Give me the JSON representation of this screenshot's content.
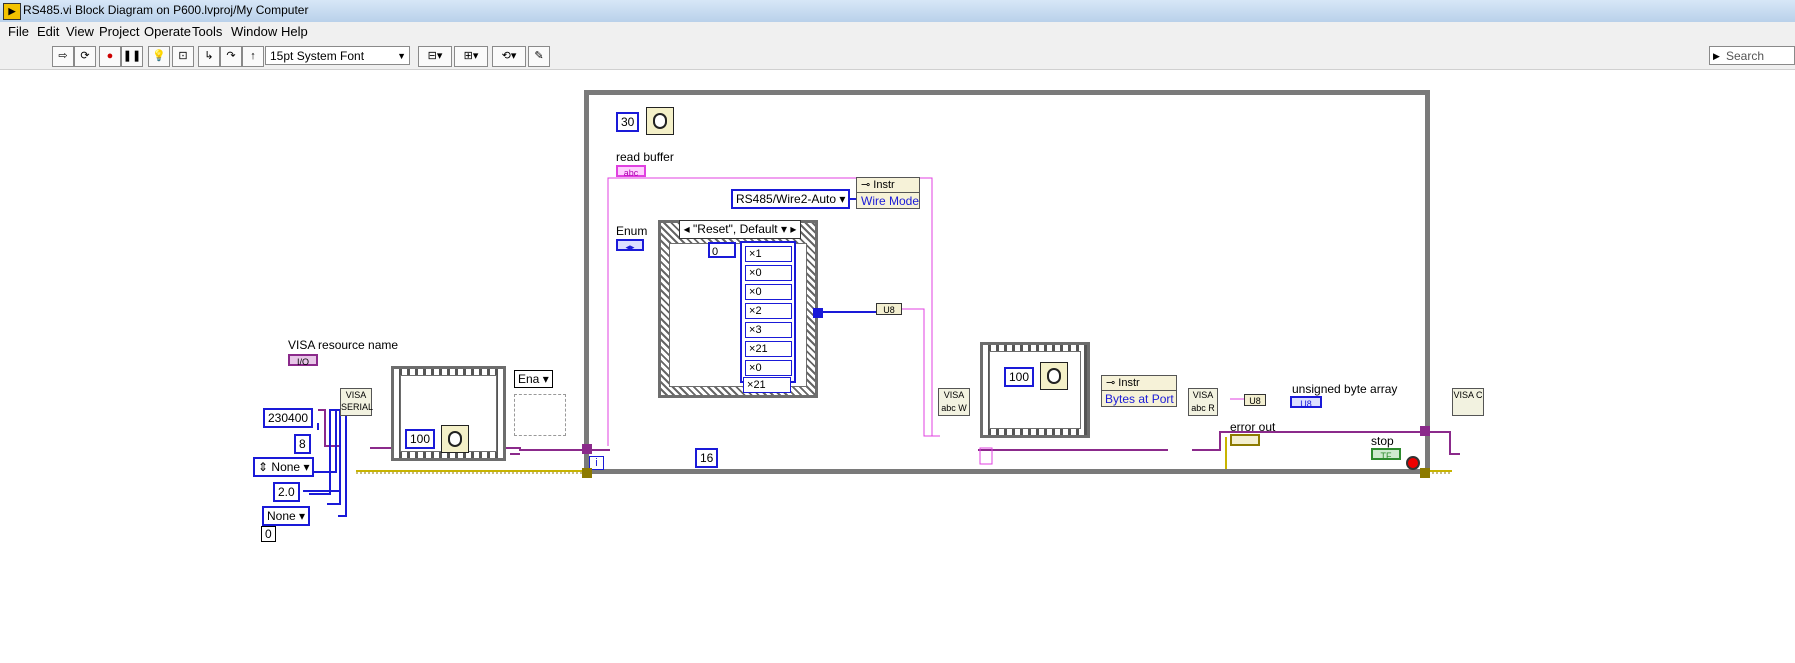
{
  "window": {
    "title": "RS485.vi Block Diagram on P600.lvproj/My Computer",
    "app_icon": "labview-icon"
  },
  "menu": [
    "File",
    "Edit",
    "View",
    "Project",
    "Operate",
    "Tools",
    "Window",
    "Help"
  ],
  "toolbar": {
    "font": "15pt System Font",
    "search_placeholder": "Search",
    "buttons": [
      "run-arrow-icon",
      "run-continuous-icon",
      "abort-icon",
      "pause-icon",
      "highlight-execution-icon",
      "retain-wire-values-icon",
      "step-into-icon",
      "step-over-icon",
      "step-out-icon",
      "align-icon",
      "distribute-icon",
      "reorder-icon",
      "cleanup-icon"
    ]
  },
  "diagram": {
    "visa_resource_label": "VISA resource name",
    "visa_resource_term": "I/O",
    "serial_node": "VISA SERIAL",
    "serial_constants": {
      "baud": "230400",
      "bits": "8",
      "parity": "None",
      "stop": "2.0",
      "flow": "None",
      "small": "0"
    },
    "wait_left": "100",
    "enable_ring": "Ena",
    "loop_wait": "30",
    "read_buffer_label": "read buffer",
    "read_buffer_term": "abc",
    "property_node_title": "Instr",
    "wire_mode_ring": "RS485/Wire2-Auto",
    "wire_mode_prop": "Wire Mode",
    "enum_label": "Enum",
    "case_selector": "\"Reset\", Default",
    "array_index": "0",
    "array_values": [
      "1",
      "0",
      "0",
      "2",
      "3",
      "21",
      "0",
      "21"
    ],
    "u8_convert": "U8",
    "write_node": "VISA abc W",
    "wait_right": "100",
    "bytes_prop_title": "Instr",
    "bytes_prop": "Bytes at Port",
    "read_node": "VISA abc R",
    "unsigned_label": "unsigned byte array",
    "u8_indicator": "U8",
    "error_out_label": "error out",
    "stop_label": "stop",
    "stop_term": "TF",
    "iteration": "i",
    "const_16": "16",
    "close_node": "VISA C",
    "colors": {
      "error_wire": "#c8b400",
      "visa_wire": "#8b2a8b",
      "string_wire": "#e040e0",
      "numeric": "#1a1ad8",
      "loop": "#7a7a7a"
    }
  }
}
